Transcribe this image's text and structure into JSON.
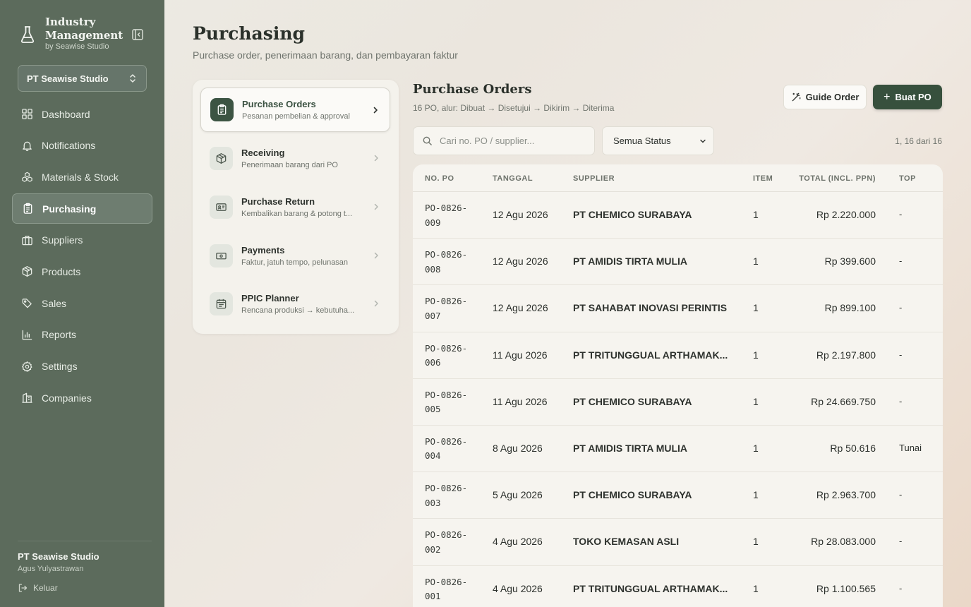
{
  "brand": {
    "name": "Industry Management",
    "by": "by Seawise Studio"
  },
  "company_selector": {
    "value": "PT Seawise Studio"
  },
  "nav": [
    {
      "label": "Dashboard",
      "icon": "grid-icon"
    },
    {
      "label": "Notifications",
      "icon": "bell-icon"
    },
    {
      "label": "Materials & Stock",
      "icon": "boxes-icon"
    },
    {
      "label": "Purchasing",
      "icon": "clipboard-icon",
      "active": true
    },
    {
      "label": "Suppliers",
      "icon": "briefcase-icon"
    },
    {
      "label": "Products",
      "icon": "package-icon"
    },
    {
      "label": "Sales",
      "icon": "tag-icon"
    },
    {
      "label": "Reports",
      "icon": "bar-chart-icon"
    },
    {
      "label": "Settings",
      "icon": "gear-icon"
    },
    {
      "label": "Companies",
      "icon": "building-icon"
    }
  ],
  "footer": {
    "company": "PT Seawise Studio",
    "user": "Agus Yulyastrawan",
    "logout": "Keluar"
  },
  "page": {
    "title": "Purchasing",
    "subtitle": "Purchase order, penerimaan barang, dan pembayaran faktur"
  },
  "submenu": [
    {
      "title": "Purchase Orders",
      "desc": "Pesanan pembelian & approval",
      "icon": "clipboard-icon",
      "active": true
    },
    {
      "title": "Receiving",
      "desc": "Penerimaan barang dari PO",
      "icon": "package-icon"
    },
    {
      "title": "Purchase Return",
      "desc": "Kembalikan barang & potong t...",
      "icon": "id-card-icon"
    },
    {
      "title": "Payments",
      "desc": "Faktur, jatuh tempo, pelunasan",
      "icon": "banknote-icon"
    },
    {
      "title": "PPIC Planner",
      "desc": "Rencana produksi → kebutuha...",
      "icon": "calendar-icon"
    }
  ],
  "orders": {
    "title": "Purchase Orders",
    "subtitle": "16 PO, alur: Dibuat → Disetujui → Dikirim → Diterima",
    "guide_label": "Guide Order",
    "new_label": "Buat PO",
    "search_placeholder": "Cari no. PO / supplier...",
    "status_value": "Semua Status",
    "count": "1, 16 dari 16",
    "columns": {
      "po": "NO. PO",
      "date": "TANGGAL",
      "supplier": "SUPPLIER",
      "item": "ITEM",
      "total": "TOTAL (INCL. PPN)",
      "top": "TOP"
    },
    "rows": [
      {
        "po1": "PO-0826-",
        "po2": "009",
        "date": "12 Agu 2026",
        "supplier": "PT CHEMICO SURABAYA",
        "item": "1",
        "total": "Rp 2.220.000",
        "top": "-"
      },
      {
        "po1": "PO-0826-",
        "po2": "008",
        "date": "12 Agu 2026",
        "supplier": "PT AMIDIS TIRTA MULIA",
        "item": "1",
        "total": "Rp 399.600",
        "top": "-"
      },
      {
        "po1": "PO-0826-",
        "po2": "007",
        "date": "12 Agu 2026",
        "supplier": "PT SAHABAT INOVASI PERINTIS",
        "item": "1",
        "total": "Rp 899.100",
        "top": "-"
      },
      {
        "po1": "PO-0826-",
        "po2": "006",
        "date": "11 Agu 2026",
        "supplier": "PT TRITUNGGUAL ARTHAMAK...",
        "item": "1",
        "total": "Rp 2.197.800",
        "top": "-"
      },
      {
        "po1": "PO-0826-",
        "po2": "005",
        "date": "11 Agu 2026",
        "supplier": "PT CHEMICO SURABAYA",
        "item": "1",
        "total": "Rp 24.669.750",
        "top": "-"
      },
      {
        "po1": "PO-0826-",
        "po2": "004",
        "date": "8 Agu 2026",
        "supplier": "PT AMIDIS TIRTA MULIA",
        "item": "1",
        "total": "Rp 50.616",
        "top": "Tunai"
      },
      {
        "po1": "PO-0826-",
        "po2": "003",
        "date": "5 Agu 2026",
        "supplier": "PT CHEMICO SURABAYA",
        "item": "1",
        "total": "Rp 2.963.700",
        "top": "-"
      },
      {
        "po1": "PO-0826-",
        "po2": "002",
        "date": "4 Agu 2026",
        "supplier": "TOKO KEMASAN ASLI",
        "item": "1",
        "total": "Rp 28.083.000",
        "top": "-"
      },
      {
        "po1": "PO-0826-",
        "po2": "001",
        "date": "4 Agu 2026",
        "supplier": "PT TRITUNGGUAL ARTHAMAK...",
        "item": "1",
        "total": "Rp 1.100.565",
        "top": "-"
      }
    ]
  }
}
